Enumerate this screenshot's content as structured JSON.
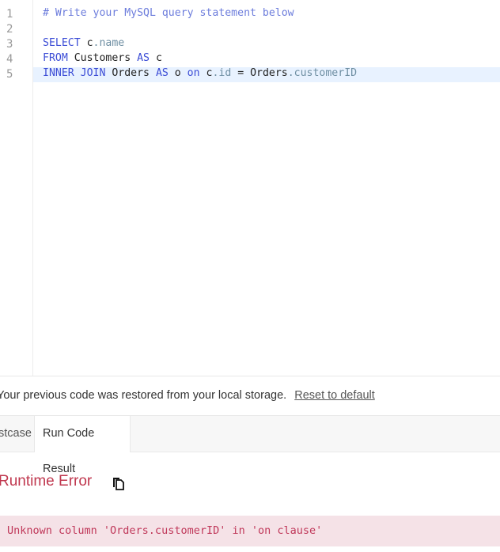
{
  "editor": {
    "line_numbers": [
      "1",
      "2",
      "3",
      "4",
      "5"
    ],
    "lines": [
      [
        {
          "t": "# Write your MySQL query statement below",
          "c": "cm"
        }
      ],
      [],
      [
        {
          "t": "SELECT",
          "c": "kw"
        },
        {
          "t": " c",
          "c": ""
        },
        {
          "t": ".name",
          "c": "pr"
        }
      ],
      [
        {
          "t": "FROM",
          "c": "kw"
        },
        {
          "t": " Customers ",
          "c": ""
        },
        {
          "t": "AS",
          "c": "kw"
        },
        {
          "t": " c",
          "c": ""
        }
      ],
      [
        {
          "t": "INNER JOIN",
          "c": "kw"
        },
        {
          "t": " Orders ",
          "c": ""
        },
        {
          "t": "AS",
          "c": "kw"
        },
        {
          "t": " o ",
          "c": ""
        },
        {
          "t": "on",
          "c": "kw"
        },
        {
          "t": " c",
          "c": ""
        },
        {
          "t": ".id",
          "c": "pr"
        },
        {
          "t": " = Orders",
          "c": ""
        },
        {
          "t": ".customerID",
          "c": "pr"
        }
      ]
    ],
    "active_line": 5
  },
  "notice": {
    "text": "Your previous code was restored from your local storage.",
    "reset_link": "Reset to default"
  },
  "tabs": {
    "testcase": "stcase",
    "run_result": "Run Code Result"
  },
  "result": {
    "title": "Runtime Error",
    "message": "Unknown column 'Orders.customerID' in 'on clause'"
  }
}
